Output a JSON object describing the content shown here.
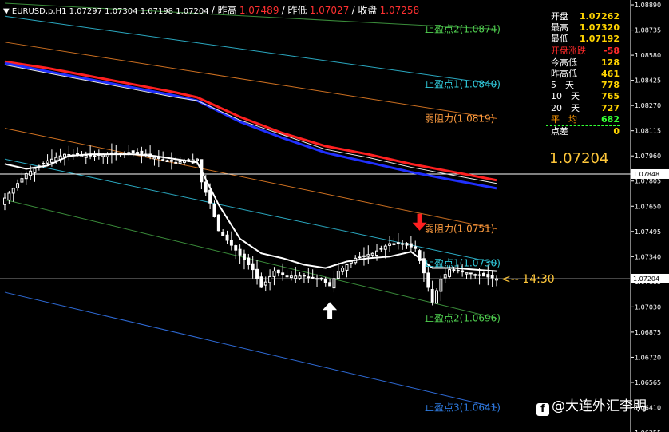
{
  "header": {
    "symbol": "EURUSD,p,H1",
    "ohlc": "1.07297 1.07304 1.07198 1.07204",
    "prev_high_label": "昨高",
    "prev_high": "1.07489",
    "prev_low_label": "昨低",
    "prev_low": "1.07027",
    "prev_close_label": "收盘",
    "prev_close": "1.07258"
  },
  "info_panel": {
    "rows": [
      {
        "label": "开盘",
        "value": "1.07262",
        "label_color": "#ffffff",
        "value_color": "#ffd400"
      },
      {
        "label": "最高",
        "value": "1.07320",
        "label_color": "#ffffff",
        "value_color": "#ffd400"
      },
      {
        "label": "最低",
        "value": "1.07192",
        "label_color": "#ffffff",
        "value_color": "#ffd400"
      },
      {
        "label": "开盘涨跌",
        "value": "-58",
        "label_color": "#ff2a2a",
        "value_color": "#ff2a2a"
      },
      {
        "label": "今高低",
        "value": "128",
        "label_color": "#ffffff",
        "value_color": "#ffd400"
      },
      {
        "label": "昨高低",
        "value": "461",
        "label_color": "#ffffff",
        "value_color": "#ffd400"
      },
      {
        "label": "5　天",
        "value": "778",
        "label_color": "#ffffff",
        "value_color": "#ffd400"
      },
      {
        "label": "10　天",
        "value": "765",
        "label_color": "#ffffff",
        "value_color": "#ffd400"
      },
      {
        "label": "20　天",
        "value": "727",
        "label_color": "#ffffff",
        "value_color": "#ffd400"
      },
      {
        "label": "平　均",
        "value": "682",
        "label_color": "#ff9900",
        "value_color": "#33ff33"
      },
      {
        "label": "点差",
        "value": "0",
        "label_color": "#ffffff",
        "value_color": "#ffd400"
      }
    ],
    "current_price": "1.07204"
  },
  "annotations": {
    "countdown": "<-- 14:30",
    "watermark": "@大连外汇李明",
    "watermark_logo": "f"
  },
  "chart_data": {
    "type": "candlestick",
    "symbol": "EURUSD",
    "timeframe": "H1",
    "ylim": [
      1.0626,
      1.089
    ],
    "y_ticks": [
      "1.08890",
      "1.08735",
      "1.08580",
      "1.08425",
      "1.08270",
      "1.08115",
      "1.07960",
      "1.07805",
      "1.07650",
      "1.07495",
      "1.07340",
      "1.07185",
      "1.07030",
      "1.06875",
      "1.06720",
      "1.06565",
      "1.06410",
      "1.06255"
    ],
    "price_line": {
      "value": 1.07204,
      "label": "1.07204"
    },
    "hline": {
      "value": 1.07848,
      "label": "1.07848"
    },
    "level_labels": [
      {
        "text": "止盈点2(1.0874)",
        "value": 1.0874,
        "color": "#50d050"
      },
      {
        "text": "止盈点1(1.0840)",
        "value": 1.084,
        "color": "#30c8d8"
      },
      {
        "text": "弱阻力(1.0819)",
        "value": 1.0819,
        "color": "#ff9d40"
      },
      {
        "text": "弱阻力(1.0751)",
        "value": 1.0751,
        "color": "#ff9d40"
      },
      {
        "text": "止盈点1(1.0730)",
        "value": 1.073,
        "color": "#30c8d8"
      },
      {
        "text": "止盈点2(1.0696)",
        "value": 1.0696,
        "color": "#50d050"
      },
      {
        "text": "止盈点3(1.0641)",
        "value": 1.0641,
        "color": "#2e7be0"
      }
    ],
    "channel_lines": [
      {
        "name": "tp2-upper",
        "color": "#3a8c3a",
        "points": [
          [
            0,
            1.089
          ],
          [
            115,
            1.0874
          ]
        ]
      },
      {
        "name": "tp1-upper",
        "color": "#2aa8c0",
        "points": [
          [
            0,
            1.0882
          ],
          [
            115,
            1.084
          ]
        ]
      },
      {
        "name": "resistance-upper",
        "color": "#cc6f20",
        "points": [
          [
            0,
            1.0866
          ],
          [
            115,
            1.0819
          ]
        ]
      },
      {
        "name": "resistance-lower",
        "color": "#cc6f20",
        "points": [
          [
            0,
            1.0813
          ],
          [
            115,
            1.0751
          ]
        ]
      },
      {
        "name": "tp1-lower",
        "color": "#2aa8c0",
        "points": [
          [
            0,
            1.0794
          ],
          [
            115,
            1.073
          ]
        ]
      },
      {
        "name": "tp2-lower",
        "color": "#3a8c3a",
        "points": [
          [
            0,
            1.0769
          ],
          [
            115,
            1.0696
          ]
        ]
      },
      {
        "name": "tp3-lower",
        "color": "#2e6ad6",
        "points": [
          [
            0,
            1.0712
          ],
          [
            115,
            1.0641
          ]
        ]
      }
    ],
    "moving_averages": [
      {
        "name": "ma-red",
        "color": "#ff2020",
        "width": 3,
        "points": [
          [
            0,
            1.0854
          ],
          [
            10,
            1.085
          ],
          [
            20,
            1.0845
          ],
          [
            30,
            1.084
          ],
          [
            40,
            1.0835
          ],
          [
            45,
            1.0832
          ],
          [
            55,
            1.082
          ],
          [
            65,
            1.081
          ],
          [
            75,
            1.0802
          ],
          [
            85,
            1.0797
          ],
          [
            95,
            1.0791
          ],
          [
            105,
            1.0786
          ],
          [
            115,
            1.0781
          ]
        ]
      },
      {
        "name": "ma-blue",
        "color": "#2030ff",
        "width": 3,
        "points": [
          [
            0,
            1.0853
          ],
          [
            10,
            1.0848
          ],
          [
            20,
            1.0843
          ],
          [
            30,
            1.0838
          ],
          [
            40,
            1.0833
          ],
          [
            45,
            1.083
          ],
          [
            55,
            1.0817
          ],
          [
            65,
            1.0807
          ],
          [
            75,
            1.0798
          ],
          [
            85,
            1.0792
          ],
          [
            95,
            1.0786
          ],
          [
            105,
            1.0781
          ],
          [
            115,
            1.0776
          ]
        ]
      },
      {
        "name": "ma-white-slow",
        "color": "#e8e8e8",
        "width": 1,
        "points": [
          [
            0,
            1.0852
          ],
          [
            10,
            1.0847
          ],
          [
            20,
            1.0842
          ],
          [
            30,
            1.0837
          ],
          [
            40,
            1.0832
          ],
          [
            45,
            1.083
          ],
          [
            55,
            1.0818
          ],
          [
            65,
            1.0809
          ],
          [
            75,
            1.08
          ],
          [
            85,
            1.0795
          ],
          [
            95,
            1.0789
          ],
          [
            105,
            1.0784
          ],
          [
            115,
            1.0779
          ]
        ]
      },
      {
        "name": "ma-white-fast",
        "color": "#ffffff",
        "width": 2,
        "points": [
          [
            0,
            1.0791
          ],
          [
            5,
            1.0788
          ],
          [
            10,
            1.079
          ],
          [
            15,
            1.0796
          ],
          [
            20,
            1.0797
          ],
          [
            30,
            1.0797
          ],
          [
            35,
            1.0796
          ],
          [
            40,
            1.0794
          ],
          [
            45,
            1.0792
          ],
          [
            50,
            1.0766
          ],
          [
            55,
            1.0745
          ],
          [
            60,
            1.0736
          ],
          [
            65,
            1.0733
          ],
          [
            70,
            1.0729
          ],
          [
            75,
            1.0727
          ],
          [
            80,
            1.0731
          ],
          [
            85,
            1.0733
          ],
          [
            90,
            1.0734
          ],
          [
            95,
            1.0737
          ],
          [
            98,
            1.0731
          ],
          [
            100,
            1.0727
          ],
          [
            105,
            1.0727
          ],
          [
            110,
            1.0726
          ],
          [
            115,
            1.0725
          ]
        ]
      }
    ],
    "candles_count": 116,
    "anchors": [
      [
        0,
        1.077
      ],
      [
        5,
        1.0785
      ],
      [
        10,
        1.0793
      ],
      [
        14,
        1.0797
      ],
      [
        20,
        1.0796
      ],
      [
        30,
        1.0798
      ],
      [
        40,
        1.0792
      ],
      [
        45,
        1.0794
      ],
      [
        46,
        1.078
      ],
      [
        48,
        1.0767
      ],
      [
        50,
        1.075
      ],
      [
        55,
        1.0735
      ],
      [
        58,
        1.0726
      ],
      [
        60,
        1.0715
      ],
      [
        63,
        1.0725
      ],
      [
        66,
        1.0722
      ],
      [
        70,
        1.0722
      ],
      [
        74,
        1.072
      ],
      [
        76,
        1.0716
      ],
      [
        78,
        1.0725
      ],
      [
        82,
        1.0733
      ],
      [
        86,
        1.0736
      ],
      [
        90,
        1.0742
      ],
      [
        93,
        1.0742
      ],
      [
        96,
        1.0739
      ],
      [
        98,
        1.0724
      ],
      [
        100,
        1.0706
      ],
      [
        102,
        1.072
      ],
      [
        104,
        1.0726
      ],
      [
        108,
        1.0724
      ],
      [
        112,
        1.0722
      ],
      [
        115,
        1.07204
      ]
    ],
    "arrows": [
      {
        "index": 76,
        "direction": "up",
        "color": "#ffffff",
        "value": 1.0706
      },
      {
        "index": 97,
        "direction": "down",
        "color": "#ff2020",
        "value": 1.075
      }
    ]
  }
}
